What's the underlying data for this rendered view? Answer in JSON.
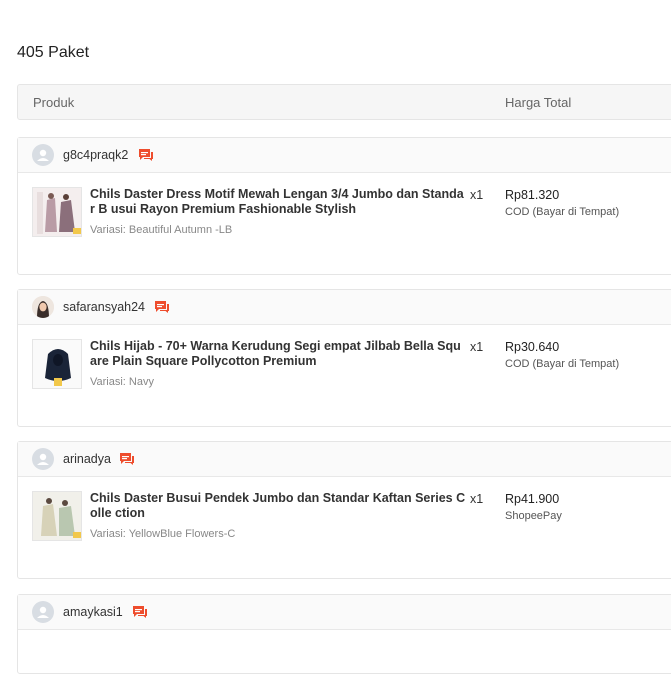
{
  "page": {
    "title": "405 Paket"
  },
  "table": {
    "col_product": "Produk",
    "col_total": "Harga Total"
  },
  "orders": [
    {
      "username": "g8c4praqk2",
      "product_name": "Chils Daster Dress Motif Mewah Lengan 3/4 Jumbo dan Standar B usui Rayon Premium Fashionable Stylish",
      "variant": "Variasi: Beautiful Autumn -LB",
      "qty": "x1",
      "price": "Rp81.320",
      "payment": "COD (Bayar di Tempat)"
    },
    {
      "username": "safaransyah24",
      "product_name": "Chils Hijab - 70+ Warna Kerudung Segi empat Jilbab Bella Square Plain Square Pollycotton Premium",
      "variant": "Variasi: Navy",
      "qty": "x1",
      "price": "Rp30.640",
      "payment": "COD (Bayar di Tempat)"
    },
    {
      "username": "arinadya",
      "product_name": "Chils Daster Busui Pendek Jumbo dan Standar Kaftan Series Colle ction",
      "variant": "Variasi: YellowBlue Flowers-C",
      "qty": "x1",
      "price": "Rp41.900",
      "payment": "ShopeePay"
    },
    {
      "username": "amaykasi1"
    }
  ],
  "colors": {
    "chat_icon": "#ee4d2d",
    "header_bg": "#f6f6f6",
    "border": "#e5e5e5"
  },
  "icons": {
    "chat": "chat-icon",
    "avatar": "default-user-icon"
  }
}
